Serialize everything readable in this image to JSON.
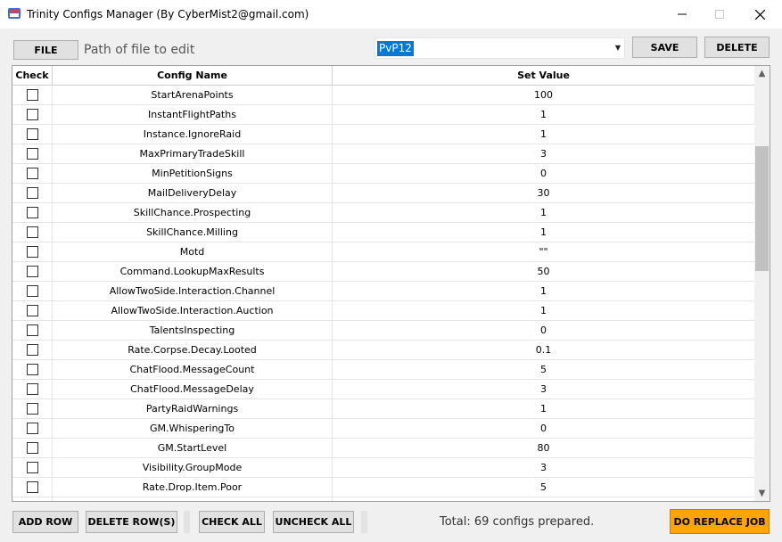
{
  "window": {
    "title": "Trinity Configs Manager (By CyberMist2@gmail.com)",
    "icon": "app-logo-icon"
  },
  "toolbar": {
    "file_label": "FILE",
    "path_label": "Path of file to edit",
    "config_select_value": "PvP12",
    "save_label": "SAVE",
    "delete_label": "DELETE"
  },
  "grid": {
    "columns": {
      "check": "Check",
      "name": "Config Name",
      "value": "Set Value"
    },
    "rows": [
      {
        "name": "StartArenaPoints",
        "value": "100"
      },
      {
        "name": "InstantFlightPaths",
        "value": "1"
      },
      {
        "name": "Instance.IgnoreRaid",
        "value": "1"
      },
      {
        "name": "MaxPrimaryTradeSkill",
        "value": "3"
      },
      {
        "name": "MinPetitionSigns",
        "value": "0"
      },
      {
        "name": "MailDeliveryDelay",
        "value": "30"
      },
      {
        "name": "SkillChance.Prospecting",
        "value": "1"
      },
      {
        "name": "SkillChance.Milling",
        "value": "1"
      },
      {
        "name": "Motd",
        "value": "\"\""
      },
      {
        "name": "Command.LookupMaxResults",
        "value": "50"
      },
      {
        "name": "AllowTwoSide.Interaction.Channel",
        "value": "1"
      },
      {
        "name": "AllowTwoSide.Interaction.Auction",
        "value": "1"
      },
      {
        "name": "TalentsInspecting",
        "value": "0"
      },
      {
        "name": "Rate.Corpse.Decay.Looted",
        "value": "0.1"
      },
      {
        "name": "ChatFlood.MessageCount",
        "value": "5"
      },
      {
        "name": "ChatFlood.MessageDelay",
        "value": "3"
      },
      {
        "name": "PartyRaidWarnings",
        "value": "1"
      },
      {
        "name": "GM.WhisperingTo",
        "value": "0"
      },
      {
        "name": "GM.StartLevel",
        "value": "80"
      },
      {
        "name": "Visibility.GroupMode",
        "value": "3"
      },
      {
        "name": "Rate.Drop.Item.Poor",
        "value": "5"
      },
      {
        "name": "",
        "value": ""
      }
    ]
  },
  "bottom": {
    "add_row_label": "ADD ROW",
    "delete_rows_label": "DELETE ROW(S)",
    "check_all_label": "CHECK ALL",
    "uncheck_all_label": "UNCHECK ALL",
    "status_text": "Total: 69 configs prepared.",
    "replace_label": "DO REPLACE JOB"
  },
  "colors": {
    "accent": "#ffa500",
    "selection": "#0078d7"
  }
}
